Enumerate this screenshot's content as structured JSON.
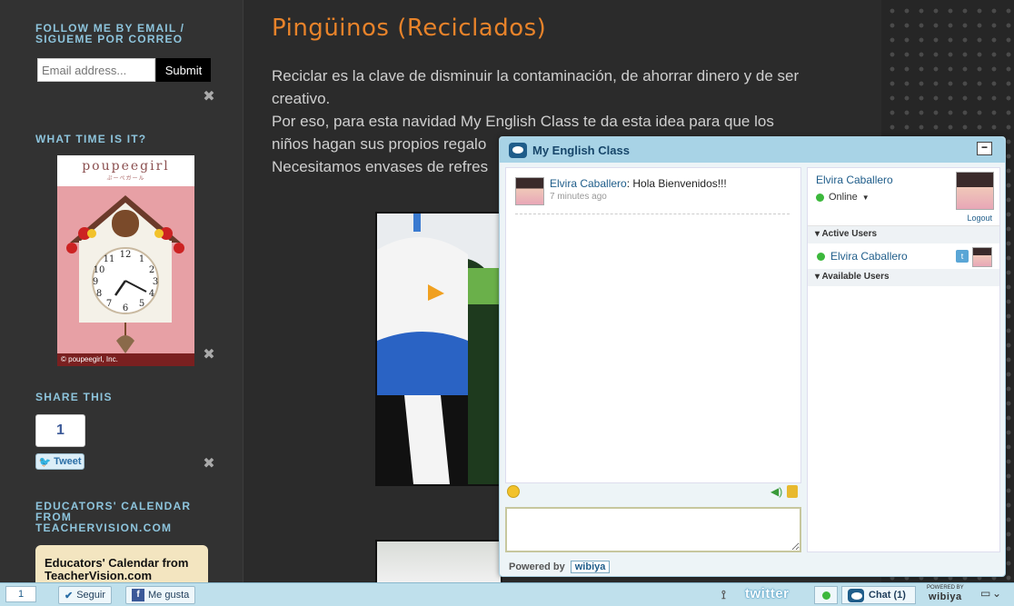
{
  "sidebar": {
    "follow_heading_1": "FOLLOW ME BY EMAIL /",
    "follow_heading_2": "SIGUEME POR CORREO",
    "email_placeholder": "Email address...",
    "submit_label": "Submit",
    "time_heading": "WHAT TIME IS IT?",
    "clock_brand": "poupeegirl",
    "clock_sub": "ぷーぺガール",
    "clock_copyright": "© poupeegirl, Inc.",
    "share_heading": "SHARE THIS",
    "share_count": "1",
    "tweet_label": "Tweet",
    "calendar_heading_1": "EDUCATORS' CALENDAR",
    "calendar_heading_2": "FROM",
    "calendar_heading_3": "TEACHERVISION.COM",
    "calendar_box_text": "Educators' Calendar from TeacherVision.com"
  },
  "post": {
    "title": "Pingüinos (Reciclados)",
    "line1": "Reciclar es la clave de disminuir la contaminación, de ahorrar dinero y de ser",
    "line2": "creativo.",
    "line3": "Por eso, para esta navidad My English Class te da esta idea para que los",
    "line4": "niños hagan sus propios regalo",
    "line5": "Necesitamos envases de refres"
  },
  "chat": {
    "title": "My English Class",
    "minimize_label": "−",
    "message": {
      "sender": "Elvira Caballero",
      "text": "Hola Bienvenidos!!!",
      "time": "7 minutes ago"
    },
    "powered_by": "Powered by",
    "wibiya": "wibiya",
    "user": {
      "name": "Elvira Caballero",
      "status": "Online",
      "logout": "Logout"
    },
    "active_users_heading": "Active Users",
    "active_users": [
      "Elvira Caballero"
    ],
    "available_users_heading": "Available Users"
  },
  "bottombar": {
    "count": "1",
    "seguir": "Seguir",
    "me_gusta": "Me gusta",
    "twitter": "twitter",
    "chat_label": "Chat (1)",
    "powered_small": "POWERED BY",
    "wibiya": "wibiya"
  },
  "colors": {
    "accent_title": "#e8832a",
    "sidebar_heading": "#8dc4dc",
    "chat_header": "#a8d3e6"
  }
}
